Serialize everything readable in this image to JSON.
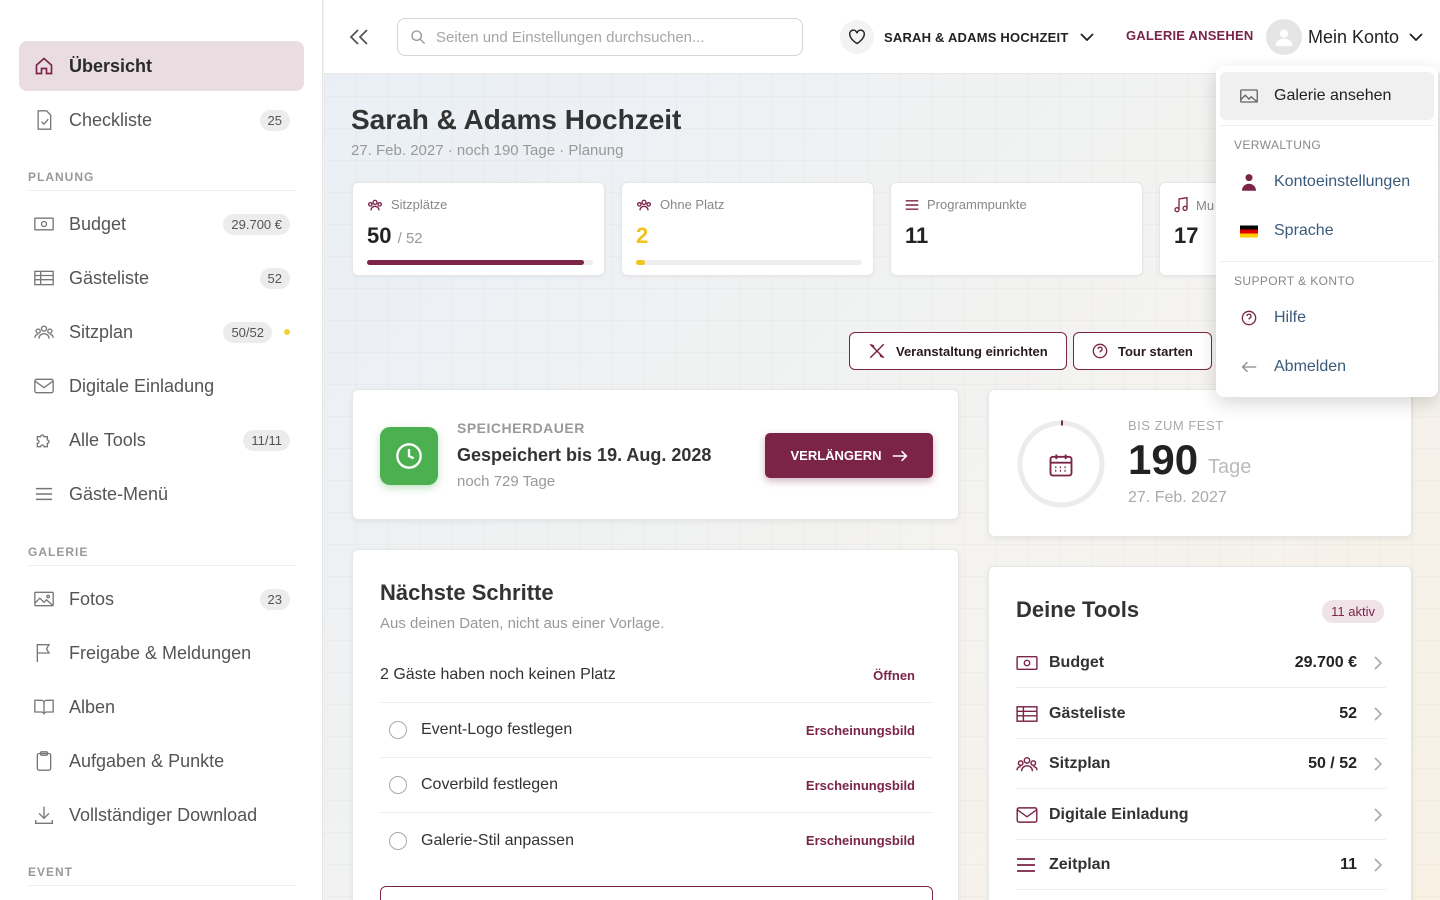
{
  "sidebar": {
    "items": [
      {
        "label": "Übersicht",
        "badge": "",
        "icon": "home-icon"
      },
      {
        "label": "Checkliste",
        "badge": "25",
        "icon": "checklist-icon"
      }
    ],
    "sections": [
      {
        "title": "PLANUNG",
        "items": [
          {
            "label": "Budget",
            "badge": "29.700 €",
            "icon": "money-icon"
          },
          {
            "label": "Gästeliste",
            "badge": "52",
            "icon": "table-icon"
          },
          {
            "label": "Sitzplan",
            "badge": "50/52",
            "icon": "people-icon",
            "dot_color": "#f2d23a"
          },
          {
            "label": "Digitale Einladung",
            "badge": "",
            "icon": "mail-icon"
          },
          {
            "label": "Alle Tools",
            "badge": "11/11",
            "icon": "puzzle-icon"
          },
          {
            "label": "Gäste-Menü",
            "badge": "",
            "icon": "menu-icon"
          }
        ]
      },
      {
        "title": "GALERIE",
        "items": [
          {
            "label": "Fotos",
            "badge": "23",
            "icon": "image-icon"
          },
          {
            "label": "Freigabe & Meldungen",
            "badge": "",
            "icon": "flag-icon"
          },
          {
            "label": "Alben",
            "badge": "",
            "icon": "book-icon"
          },
          {
            "label": "Aufgaben & Punkte",
            "badge": "",
            "icon": "clipboard-icon"
          },
          {
            "label": "Vollständiger Download",
            "badge": "",
            "icon": "download-icon"
          }
        ]
      },
      {
        "title": "EVENT",
        "items": []
      }
    ]
  },
  "topbar": {
    "search_placeholder": "Seiten und Einstellungen durchsuchen...",
    "event_name": "SARAH & ADAMS HOCHZEIT",
    "gallery_link": "GALERIE ANSEHEN",
    "account_label": "Mein Konto"
  },
  "header": {
    "title": "Sarah & Adams Hochzeit",
    "subtitle": "27. Feb. 2027 · noch 190 Tage · Planung"
  },
  "stats": [
    {
      "label": "Sitzplätze",
      "value": "50",
      "of": "/ 52",
      "progress": 0.96,
      "color": "#7b2447",
      "icon": "people-icon"
    },
    {
      "label": "Ohne Platz",
      "value": "2",
      "of": "",
      "progress": 0.04,
      "color": "#f2c31a",
      "icon": "people-icon"
    },
    {
      "label": "Programmpunkte",
      "value": "11",
      "of": "",
      "icon": "list-icon"
    },
    {
      "label": "Mu",
      "value": "17",
      "of": "",
      "icon": "music-icon"
    }
  ],
  "actions": {
    "setup_label": "Veranstaltung einrichten",
    "tour_label": "Tour starten"
  },
  "storage": {
    "label": "SPEICHERDAUER",
    "title": "Gespeichert bis 19. Aug. 2028",
    "sub": "noch 729 Tage",
    "button": "VERLÄNGERN",
    "accent": "#4caf50"
  },
  "countdown": {
    "label": "BIS ZUM FEST",
    "number": "190",
    "unit": "Tage",
    "date": "27. Feb. 2027"
  },
  "next_steps": {
    "title": "Nächste Schritte",
    "subtitle": "Aus deinen Daten, nicht aus einer Vorlage.",
    "rows": [
      {
        "text": "2 Gäste haben noch keinen Platz",
        "action": "Öffnen",
        "checkbox": false
      },
      {
        "text": "Event-Logo festlegen",
        "action": "Erscheinungsbild",
        "checkbox": true
      },
      {
        "text": "Coverbild festlegen",
        "action": "Erscheinungsbild",
        "checkbox": true
      },
      {
        "text": "Galerie-Stil anpassen",
        "action": "Erscheinungsbild",
        "checkbox": true
      }
    ]
  },
  "tools": {
    "title": "Deine Tools",
    "badge": "11 aktiv",
    "rows": [
      {
        "label": "Budget",
        "value": "29.700 €",
        "icon": "money-icon"
      },
      {
        "label": "Gästeliste",
        "value": "52",
        "icon": "table-icon"
      },
      {
        "label": "Sitzplan",
        "value": "50 / 52",
        "icon": "people-icon"
      },
      {
        "label": "Digitale Einladung",
        "value": "",
        "icon": "mail-icon"
      },
      {
        "label": "Zeitplan",
        "value": "11",
        "icon": "list-icon"
      }
    ]
  },
  "account_menu": {
    "top_item": "Galerie ansehen",
    "section1": "VERWALTUNG",
    "items1": [
      "Kontoeinstellungen",
      "Sprache"
    ],
    "section2": "SUPPORT & KONTO",
    "items2": [
      "Hilfe",
      "Abmelden"
    ]
  },
  "colors": {
    "brand": "#7b2447",
    "link": "#3a5a7a"
  }
}
